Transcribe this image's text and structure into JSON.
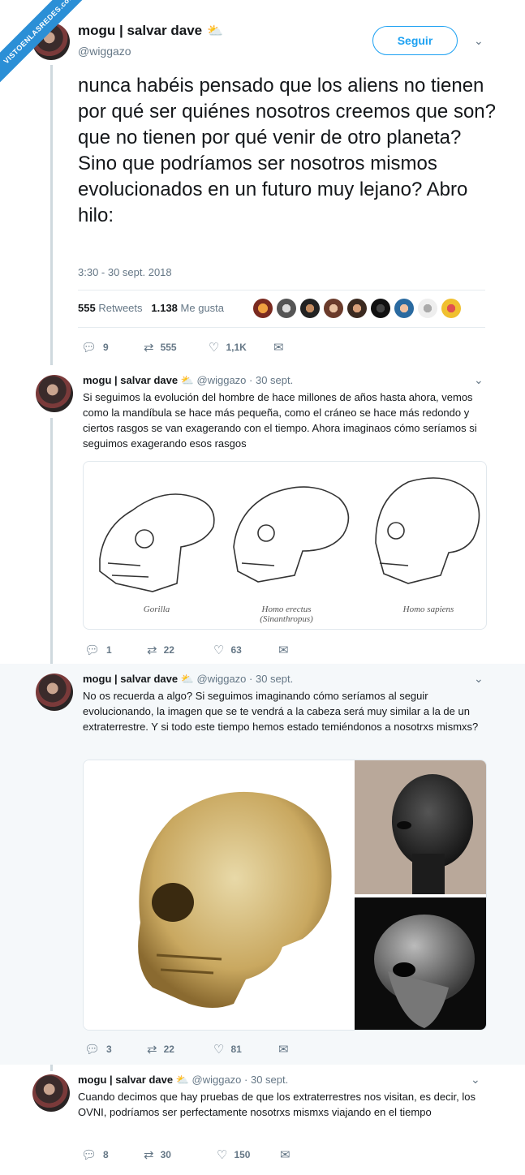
{
  "watermark": "VISTOENLASREDES.com",
  "main": {
    "name": "mogu | salvar dave",
    "handle": "@wiggazo",
    "follow_label": "Seguir",
    "text": "nunca habéis pensado que los aliens no tienen por qué ser quiénes nosotros creemos que son? que no tienen por qué venir de otro planeta? Sino que podríamos ser nosotros mismos evolucionados en un futuro muy lejano? Abro hilo:",
    "timestamp": "3:30 - 30 sept. 2018",
    "retweets_count": "555",
    "retweets_label": "Retweets",
    "likes_count": "1.138",
    "likes_label": "Me gusta",
    "replies": "9",
    "rts": "555",
    "favs": "1,1K"
  },
  "replies": [
    {
      "name": "mogu | salvar dave",
      "handle_date": "@wiggazo · 30 sept.",
      "text": "Si seguimos la evolución del hombre de hace millones de años hasta ahora, vemos como la mandíbula se hace más pequeña, como el cráneo se hace más redondo y ciertos rasgos se van exagerando con el tiempo. Ahora imaginaos cómo seríamos si seguimos exagerando esos rasgos",
      "media_labels": [
        "Gorilla",
        "Homo erectus\n(Sinanthropus)",
        "Homo sapiens"
      ],
      "replies": "1",
      "rts": "22",
      "favs": "63"
    },
    {
      "name": "mogu | salvar dave",
      "handle_date": "@wiggazo · 30 sept.",
      "text": "No os recuerda a algo? Si seguimos imaginando cómo seríamos al seguir evolucionando, la imagen que se te vendrá a la cabeza será muy similar a la de un extraterrestre. Y si todo este tiempo hemos estado temiéndonos a nosotrxs mismxs?",
      "replies": "3",
      "rts": "22",
      "favs": "81"
    },
    {
      "name": "mogu | salvar dave",
      "handle_date": "@wiggazo · 30 sept.",
      "text": "Cuando decimos que hay pruebas de que los extraterrestres nos visitan, es decir, los OVNI, podríamos ser perfectamente nosotrxs mismxs viajando en el tiempo",
      "replies": "8",
      "rts": "30",
      "favs": "150"
    }
  ],
  "icons": {
    "reply": "speech-bubble-icon",
    "retweet": "retweet-icon",
    "like": "heart-icon",
    "dm": "envelope-icon",
    "chevron": "chevron-down-icon",
    "sun": "sun-behind-cloud-icon"
  },
  "colors": {
    "accent": "#1da1f2",
    "muted": "#657786",
    "highlight_bg": "#f5f8fa",
    "ribbon": "#2b8fd6"
  }
}
